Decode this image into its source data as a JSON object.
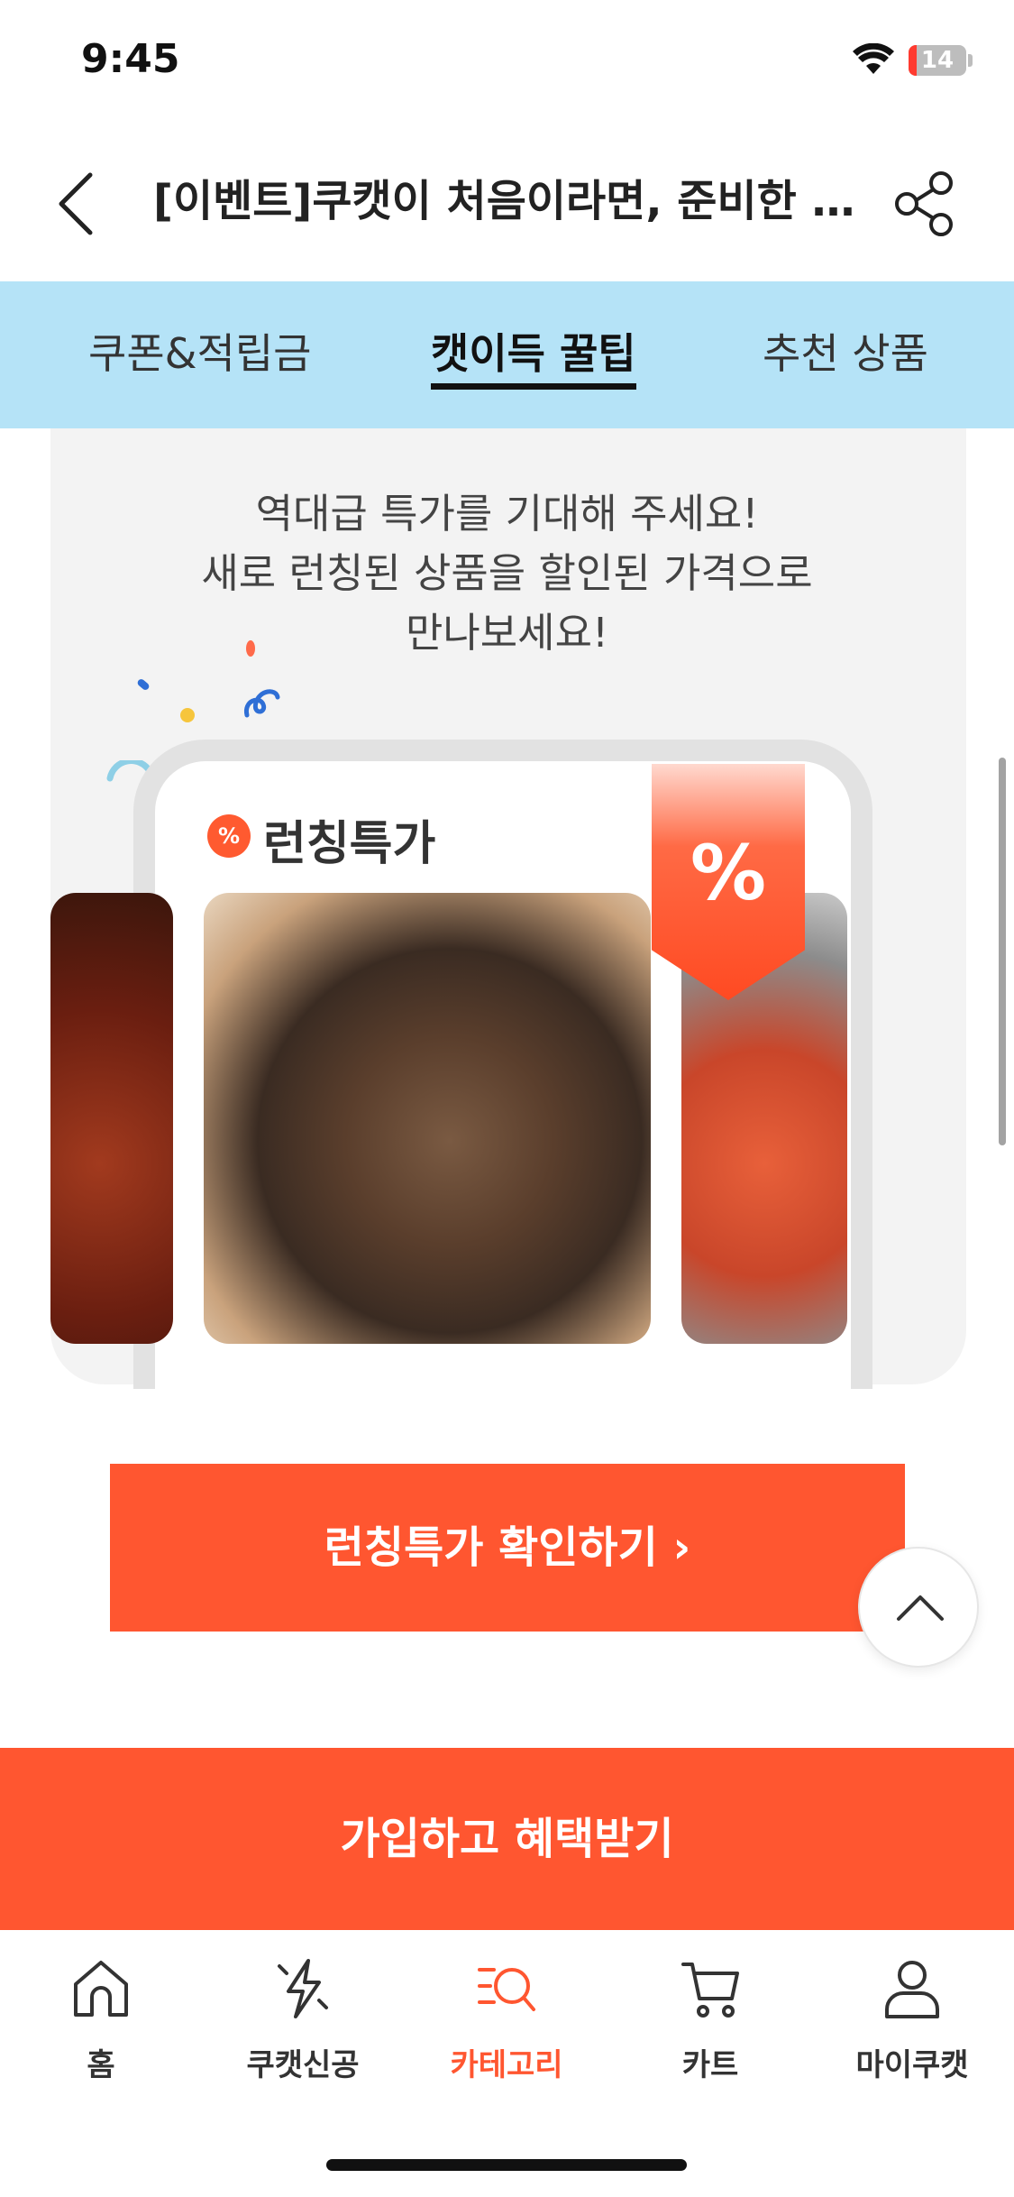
{
  "status_bar": {
    "time": "9:45",
    "battery_level": "14",
    "battery_fraction": 0.14,
    "battery_color": "#ff3b30"
  },
  "header": {
    "title": "[이벤트]쿠캣이 처음이라면, 준비한 혜택 모두 받아가세요!",
    "back_icon": "chevron-left-icon",
    "share_icon": "share-icon"
  },
  "tabs": [
    {
      "label": "쿠폰&적립금",
      "active": false
    },
    {
      "label": "캣이득 꿀팁",
      "active": true
    },
    {
      "label": "추천 상품",
      "active": false
    }
  ],
  "tabs_bg_color": "#b5e3f7",
  "promo": {
    "lines": [
      "역대급 특가를 기대해 주세요!",
      "새로 런칭된 상품을 할인된 가격으로",
      "만나보세요!"
    ],
    "badge_symbol": "%",
    "section_label": "런칭특가",
    "sale_flag_symbol": "%"
  },
  "cta": {
    "label": "런칭특가 확인하기 ›"
  },
  "signup": {
    "label": "가입하고 혜택받기"
  },
  "accent_color": "#ff5630",
  "bottom_nav": [
    {
      "label": "홈",
      "icon": "home-icon",
      "active": false
    },
    {
      "label": "쿠캣신공",
      "icon": "lightning-icon",
      "active": false
    },
    {
      "label": "카테고리",
      "icon": "category-search-icon",
      "active": true
    },
    {
      "label": "카트",
      "icon": "cart-icon",
      "active": false
    },
    {
      "label": "마이쿠캣",
      "icon": "person-icon",
      "active": false
    }
  ]
}
